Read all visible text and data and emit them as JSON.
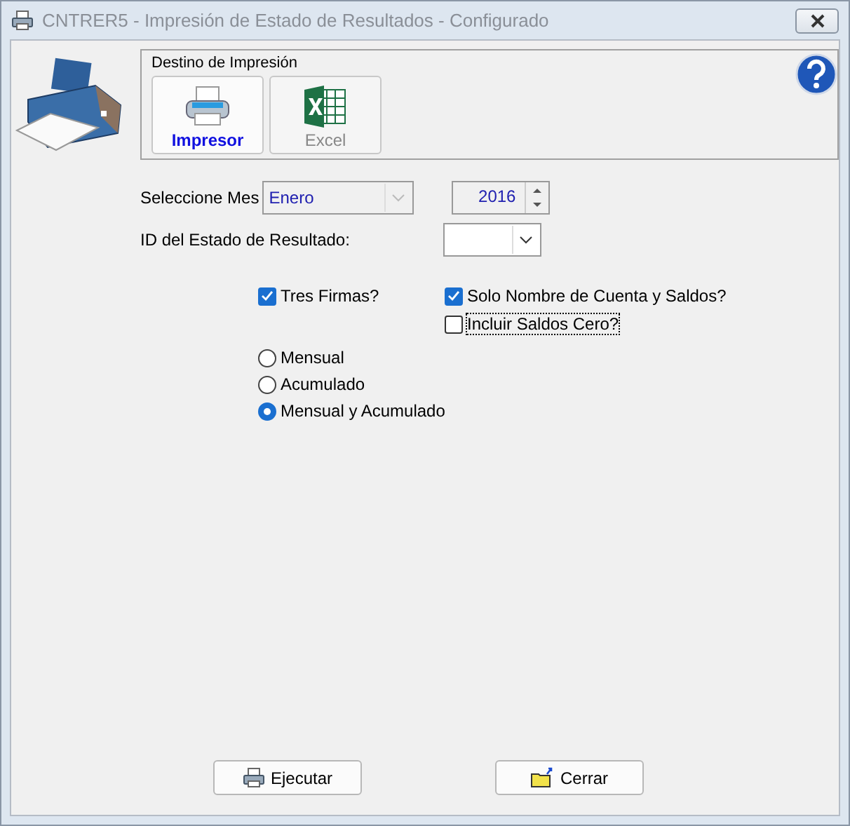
{
  "window": {
    "title": "CNTRER5 - Impresión de Estado de Resultados - Configurado"
  },
  "destination": {
    "title": "Destino de Impresión",
    "options": [
      {
        "label": "Impresor",
        "kind": "printer",
        "selected": true
      },
      {
        "label": "Excel",
        "kind": "excel",
        "selected": false
      }
    ]
  },
  "month": {
    "label": "Seleccione Mes",
    "value": "Enero",
    "disabled": true
  },
  "year": {
    "value": "2016"
  },
  "statement_id": {
    "label": "ID del Estado de Resultado:"
  },
  "checkboxes": [
    {
      "label": "Tres Firmas?",
      "checked": true,
      "focused": false
    },
    {
      "label": "Solo Nombre de Cuenta y Saldos?",
      "checked": true,
      "focused": false
    },
    {
      "label": "Incluir Saldos Cero?",
      "checked": false,
      "focused": true
    }
  ],
  "period": [
    {
      "label": "Mensual",
      "selected": false
    },
    {
      "label": "Acumulado",
      "selected": false
    },
    {
      "label": "Mensual y Acumulado",
      "selected": true
    }
  ],
  "buttons": [
    {
      "label": "Ejecutar",
      "kind": "run"
    },
    {
      "label": "Cerrar",
      "kind": "close"
    }
  ]
}
